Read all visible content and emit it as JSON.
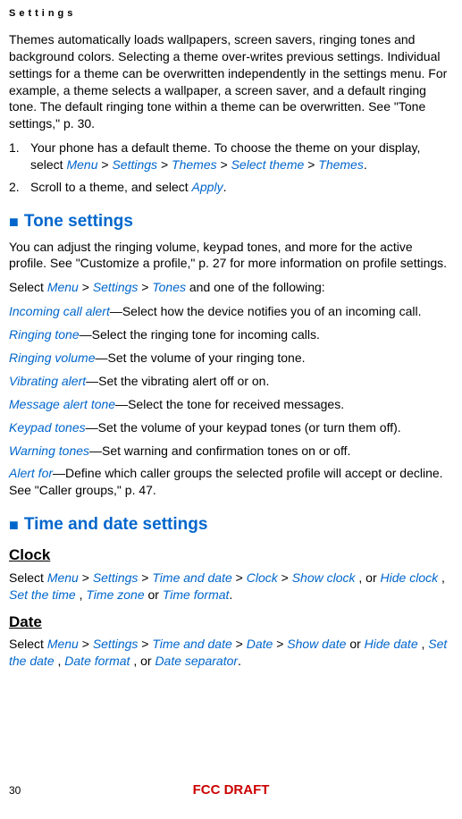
{
  "header": {
    "title": "Settings"
  },
  "intro": {
    "paragraph": "Themes automatically loads wallpapers, screen savers, ringing tones and background colors. Selecting a theme over-writes previous settings. Individual settings for a theme can be overwritten independently in the settings menu. For example, a theme selects a wallpaper, a screen saver, and a default ringing tone. The default ringing tone within a theme can be overwritten. See \"Tone settings,\" p. 30."
  },
  "steps": {
    "step1_prefix": "Your phone has a default theme. To choose the theme on your display, select ",
    "step1_menu": "Menu",
    "step1_settings": "Settings",
    "step1_themes": "Themes",
    "step1_selecttheme": "Select theme",
    "step1_themes2": "Themes",
    "step2_prefix": " Scroll to a theme, and select ",
    "step2_apply": "Apply"
  },
  "tone_section": {
    "title": "Tone settings",
    "intro": "You can adjust the ringing volume, keypad tones, and more for the active profile. See \"Customize a profile,\" p. 27 for more information on profile settings.",
    "select_prefix": "Select ",
    "select_menu": "Menu",
    "select_settings": "Settings",
    "select_tones": "Tones",
    "select_suffix": " and one of the following:",
    "options": [
      {
        "name": "Incoming call alert",
        "desc": "—Select how the device notifies you of an incoming call."
      },
      {
        "name": "Ringing tone",
        "desc": "—Select the ringing tone for incoming calls."
      },
      {
        "name": "Ringing volume",
        "desc": "—Set the volume of your ringing tone."
      },
      {
        "name": "Vibrating alert",
        "desc": "—Set the vibrating alert off or on."
      },
      {
        "name": "Message alert tone",
        "desc": "—Select the tone for received messages."
      },
      {
        "name": "Keypad tones",
        "desc": "—Set the volume of your keypad tones (or turn them off)."
      },
      {
        "name": "Warning tones",
        "desc": "—Set warning and confirmation tones on or off."
      },
      {
        "name": "Alert for",
        "desc": "—Define which caller groups the selected profile will accept or decline. See \"Caller groups,\" p. 47."
      }
    ]
  },
  "timedate_section": {
    "title": "Time and date settings",
    "clock_heading": "Clock",
    "clock_select": "Select ",
    "clock_menu": "Menu",
    "clock_settings": "Settings",
    "clock_timeanddate": "Time and date",
    "clock_clock": "Clock",
    "clock_showclock": "Show clock",
    "clock_or1": ", or ",
    "clock_hideclock": "Hide clock",
    "clock_comma1": ", ",
    "clock_setthetime": "Set the time",
    "clock_comma2": ", ",
    "clock_timezone": "Time zone",
    "clock_or2": " or ",
    "clock_timeformat": "Time format",
    "date_heading": "Date",
    "date_select": "Select ",
    "date_menu": "Menu",
    "date_settings": "Settings",
    "date_timeanddate": "Time and date",
    "date_date": "Date",
    "date_showdate": "Show date",
    "date_or1": " or ",
    "date_hidedate": "Hide date",
    "date_comma1": ", ",
    "date_setthedate": "Set the date",
    "date_comma2": ", ",
    "date_dateformat": "Date format",
    "date_comma3": ", or ",
    "date_dateseparator": "Date separator"
  },
  "footer": {
    "page": "30",
    "draft": "FCC DRAFT"
  }
}
